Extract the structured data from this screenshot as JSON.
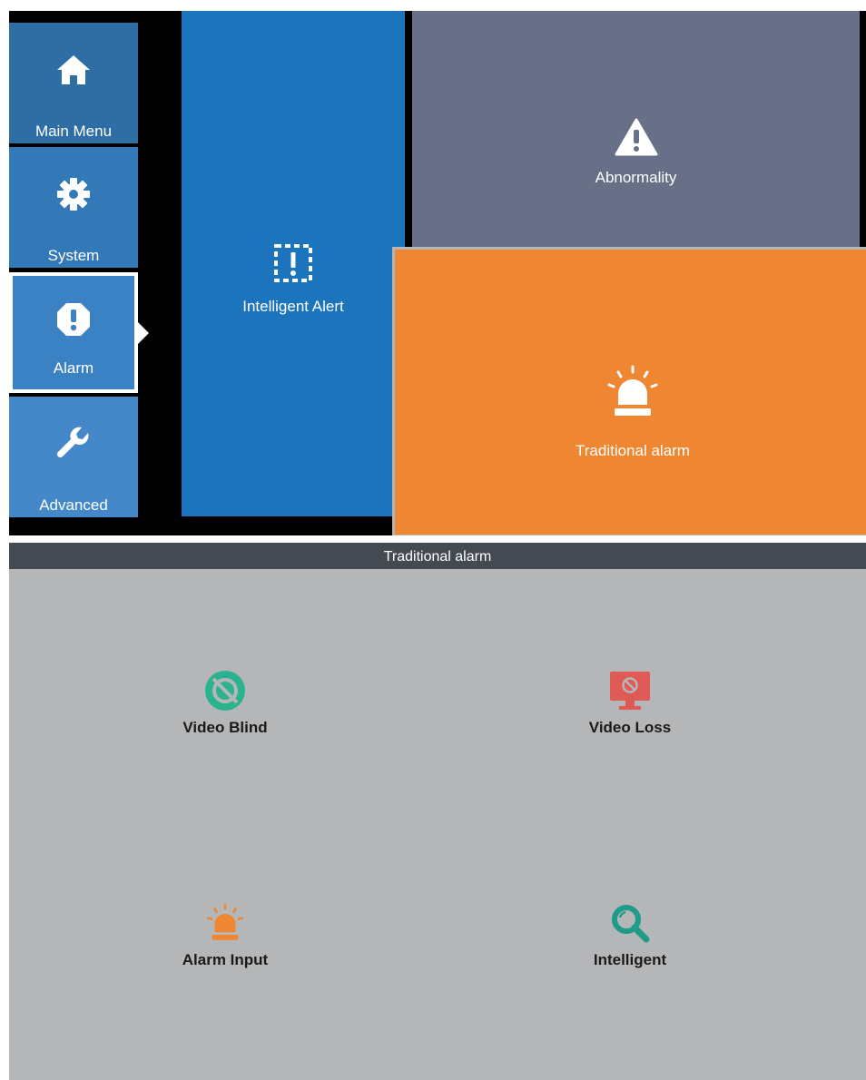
{
  "sidebar": {
    "items": [
      {
        "label": "Main Menu",
        "icon": "home-icon",
        "color": "#2f6ea4"
      },
      {
        "label": "System",
        "icon": "gear-icon",
        "color": "#3379b8"
      },
      {
        "label": "Alarm",
        "icon": "alert-octagon-icon",
        "color": "#3b82c4",
        "selected": true
      },
      {
        "label": "Advanced",
        "icon": "wrench-icon",
        "color": "#4488c9"
      }
    ]
  },
  "tiles": {
    "intelligent_alert": {
      "label": "Intelligent Alert",
      "icon": "dashed-alert-icon",
      "color": "#1c74bc"
    },
    "abnormality": {
      "label": "Abnormality",
      "icon": "warning-triangle-icon",
      "color": "#687088"
    },
    "traditional_alarm": {
      "label": "Traditional alarm",
      "icon": "siren-icon",
      "color": "#ef8631"
    }
  },
  "panel": {
    "title": "Traditional alarm",
    "options": [
      {
        "label": "Video Blind",
        "icon": "video-blind-icon",
        "color": "#2bb38f"
      },
      {
        "label": "Video Loss",
        "icon": "video-loss-icon",
        "color": "#e05a55"
      },
      {
        "label": "Alarm Input",
        "icon": "siren-icon",
        "color": "#ef8631"
      },
      {
        "label": "Intelligent",
        "icon": "magnifier-icon",
        "color": "#1e9c88"
      }
    ]
  }
}
